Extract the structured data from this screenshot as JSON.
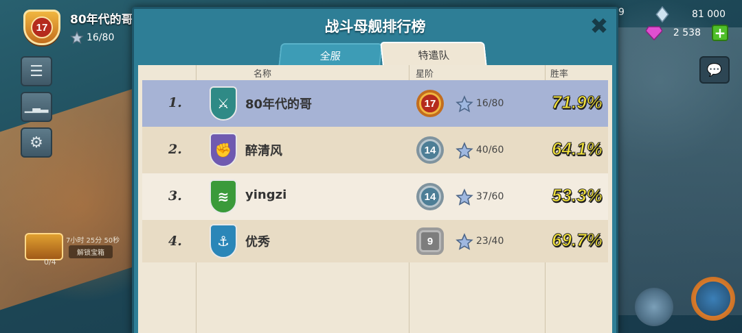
{
  "player": {
    "level": "17",
    "name": "80年代的哥",
    "stars": "16/80"
  },
  "hud": {
    "partial_resource": "9",
    "diamonds": "81 000",
    "gems": "2 538",
    "add_label": "+",
    "chest_timer": "7小时 25分 50秒",
    "chest_subtitle": "解锁宝箱",
    "chest_count": "0/4"
  },
  "modal": {
    "title": "战斗母舰排行榜",
    "close": "✖",
    "tabs": [
      {
        "label": "全服",
        "selected": false
      },
      {
        "label": "特遣队",
        "selected": true
      }
    ],
    "columns": {
      "name": "名称",
      "tier": "星阶",
      "winrate": "胜率"
    },
    "rows": [
      {
        "rank": "1.",
        "name": "80年代的哥",
        "tier": "17",
        "tier_style": "gold",
        "stars": "16/80",
        "winrate": "71.9%",
        "emblem": "crossed-swords-icon",
        "emblem_color": "#2f8a86",
        "highlight": true
      },
      {
        "rank": "2.",
        "name": "醉清风",
        "tier": "14",
        "tier_style": "silver",
        "stars": "40/60",
        "winrate": "64.1%",
        "emblem": "fist-icon",
        "emblem_color": "#6f5ab0",
        "highlight": false
      },
      {
        "rank": "3.",
        "name": "yingzi",
        "tier": "14",
        "tier_style": "silver",
        "stars": "37/60",
        "winrate": "53.3%",
        "emblem": "chevron-rank-icon",
        "emblem_color": "#3a9a3a",
        "highlight": false
      },
      {
        "rank": "4.",
        "name": "优秀",
        "tier": "9",
        "tier_style": "steel",
        "stars": "23/40",
        "winrate": "69.7%",
        "emblem": "trident-icon",
        "emblem_color": "#2a86b8",
        "highlight": false
      }
    ]
  }
}
